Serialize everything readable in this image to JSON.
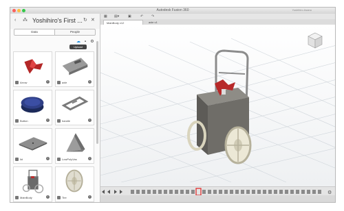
{
  "window": {
    "title": "Autodesk Fusion 360",
    "user": "Yoshihiro Asano"
  },
  "panel": {
    "project_title": "Yoshihiro's First ...",
    "tabs": [
      "Data",
      "People"
    ],
    "upload_label": "Upload",
    "items": [
      {
        "name": "Arrow"
      },
      {
        "name": "axle"
      },
      {
        "name": "Button"
      },
      {
        "name": "handle"
      },
      {
        "name": "lid"
      },
      {
        "name": "LowPolyVas"
      },
      {
        "name": "MainBody"
      },
      {
        "name": "Tire"
      }
    ]
  },
  "toolbar": {
    "undo_label": "↶",
    "redo_label": "↷"
  },
  "doc_tabs": [
    {
      "label": "MainBody v12",
      "active": true
    },
    {
      "label": "axle v1",
      "active": false
    }
  ],
  "colors": {
    "accent": "#1f8fdd",
    "tab_active": "#ffffff",
    "timeline_marker": "#e02020"
  },
  "icons": {
    "back": "chevron-left-icon",
    "refresh": "refresh-icon",
    "search": "search-icon",
    "close": "close-icon",
    "grid": "grid-icon",
    "save": "save-icon",
    "info": "info-icon",
    "view_cube": "view-cube-icon",
    "settings": "gear-icon"
  }
}
